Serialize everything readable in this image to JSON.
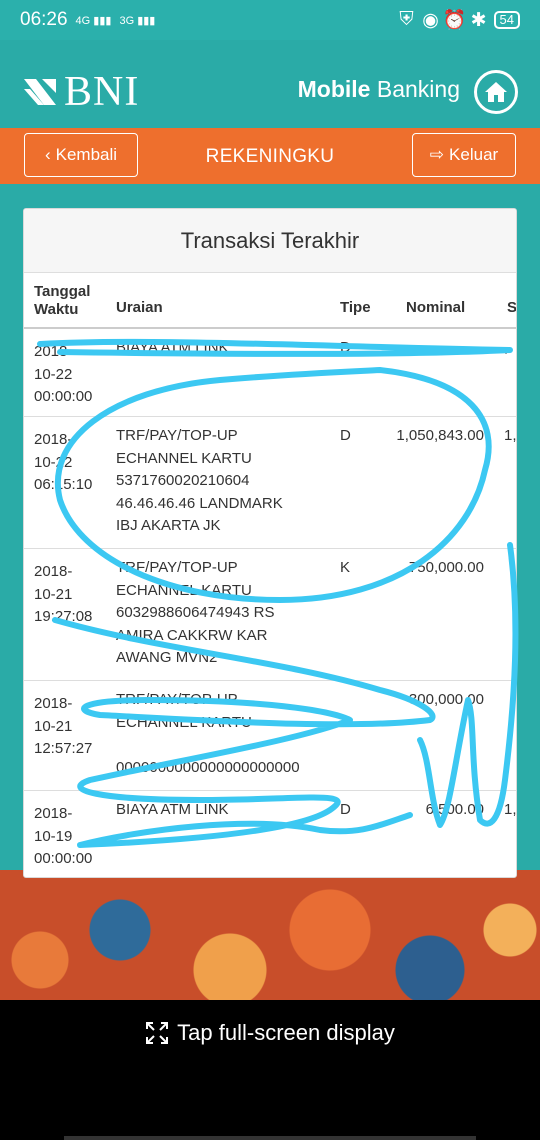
{
  "status_bar": {
    "time": "06:26",
    "network_1": "4G",
    "network_2": "3G",
    "battery": "54"
  },
  "header": {
    "logo_text": "BNI",
    "title_bold": "Mobile",
    "title_regular": "Banking"
  },
  "navbar": {
    "back_label": "Kembali",
    "title": "REKENINGKU",
    "exit_label": "Keluar"
  },
  "card": {
    "title": "Transaksi Terakhir",
    "columns": {
      "date_line1": "Tanggal",
      "date_line2": "Waktu",
      "desc": "Uraian",
      "type": "Tipe",
      "amount": "Nominal",
      "extra": "S"
    },
    "rows": [
      {
        "date": [
          "2018-",
          "10-22",
          "00:00:00"
        ],
        "desc": [
          "BIAYA ATM LINK"
        ],
        "type": "D",
        "amount": "",
        "extra": ","
      },
      {
        "date": [
          "2018-",
          "10-22",
          "06:15:10"
        ],
        "desc": [
          "TRF/PAY/TOP-UP",
          "ECHANNEL KARTU",
          "5371760020210604",
          "46.46.46.46 LANDMARK",
          "IBJ AKARTA JK"
        ],
        "type": "D",
        "amount": "1,050,843.00",
        "extra": "1,"
      },
      {
        "date": [
          "2018-",
          "10-21",
          "19:27:08"
        ],
        "desc": [
          "TRF/PAY/TOP-UP",
          "ECHANNEL KARTU",
          "6032988606474943 RS",
          "AMIRA CAKKRW KAR",
          "AWANG MVN2"
        ],
        "type": "K",
        "amount": "750,000.00",
        "extra": ""
      },
      {
        "date": [
          "2018-",
          "10-21",
          "12:57:27"
        ],
        "desc": [
          "TRF/PAY/TOP-UP",
          "ECHANNEL KARTU",
          "",
          "0000000000000000000000"
        ],
        "type": "",
        "amount": "300,000.00",
        "extra": ""
      },
      {
        "date": [
          "2018-",
          "10-19",
          "00:00:00"
        ],
        "desc": [
          "BIAYA ATM LINK"
        ],
        "type": "D",
        "amount": "6,500.00",
        "extra": "1,"
      }
    ]
  },
  "footer": {
    "fullscreen_label": "Tap full-screen display"
  },
  "colors": {
    "teal": "#2aaba7",
    "orange": "#ee6f2d",
    "scribble": "#3cc8f2"
  }
}
